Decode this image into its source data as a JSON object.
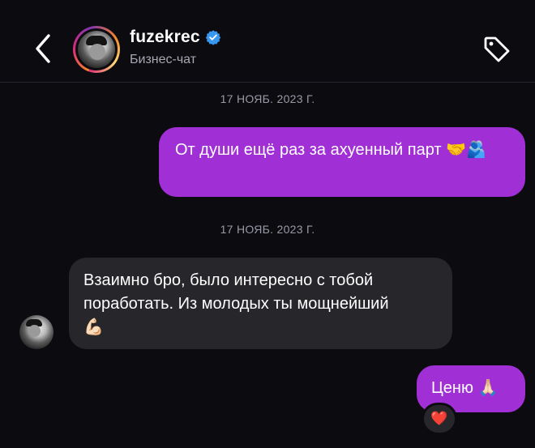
{
  "header": {
    "back_icon": "chevron-left-icon",
    "username": "fuzekrec",
    "verified_icon": "verified-badge-icon",
    "subtitle": "Бизнес-чат",
    "tag_icon": "tag-icon"
  },
  "messages": [
    {
      "date": "17 НОЯБ. 2023 Г.",
      "direction": "outgoing",
      "text": "От души ещё раз за ахуенный парт 🤝🫂"
    },
    {
      "date": "17 НОЯБ. 2023 Г.",
      "direction": "incoming",
      "line1": "Взаимно бро, было интересно с тобой",
      "line2": "поработать. Из молодых ты мощнейший",
      "line3": "💪🏻"
    },
    {
      "direction": "outgoing",
      "text": "Ценю 🙏🏻",
      "reaction": "❤️"
    }
  ],
  "colors": {
    "background": "#0b0b10",
    "outgoing_bubble": "#a12fd6",
    "incoming_bubble": "#26262b",
    "verified": "#3897f0"
  }
}
